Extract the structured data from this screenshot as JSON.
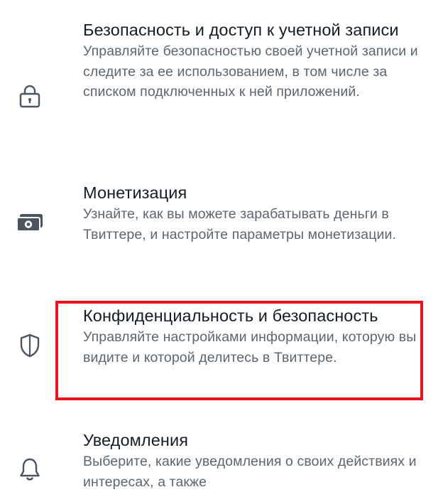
{
  "settings": {
    "items": [
      {
        "title": "Безопасность и доступ к учетной записи",
        "description": "Управляйте безопасностью своей учетной записи и следите за ее использованием, в том числе за списком подключенных к ней приложений.",
        "icon": "lock-icon"
      },
      {
        "title": "Монетизация",
        "description": "Узнайте, как вы можете зарабатывать деньги в Твиттере, и настройте параметры монетизации.",
        "icon": "money-icon"
      },
      {
        "title": "Конфиденциальность и безопасность",
        "description": "Управляйте настройками информации, которую вы видите и которой делитесь в Твиттере.",
        "icon": "shield-icon",
        "highlighted": true
      },
      {
        "title": "Уведомления",
        "description": "Выберите, какие уведомления о своих действиях и интересах, а также",
        "icon": "bell-icon"
      }
    ]
  },
  "colors": {
    "title_text": "#141d26",
    "description_text": "#5b6670",
    "highlight_border": "#e8131d",
    "icon_stroke": "#4a5560"
  }
}
